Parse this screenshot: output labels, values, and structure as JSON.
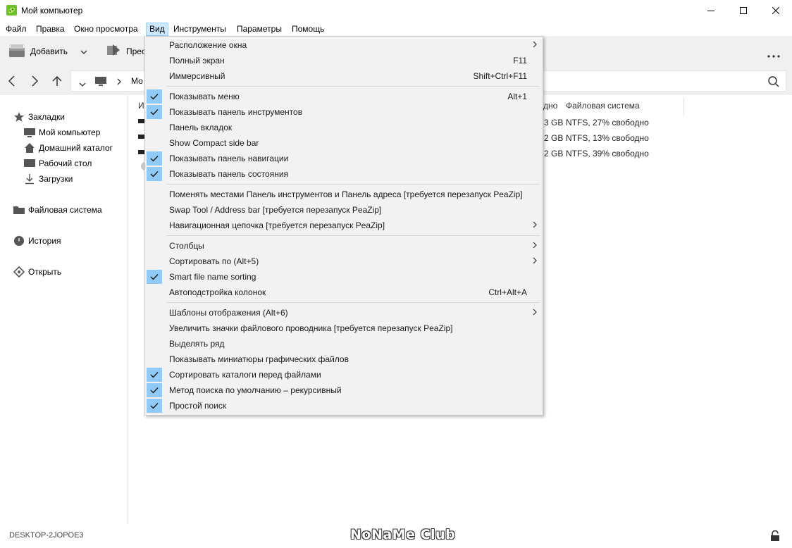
{
  "window": {
    "title": "Мой компьютер"
  },
  "menubar": {
    "items": [
      {
        "label": "Файл"
      },
      {
        "label": "Правка"
      },
      {
        "label": "Окно просмотра"
      },
      {
        "label": "Вид"
      },
      {
        "label": "Инструменты"
      },
      {
        "label": "Параметры"
      },
      {
        "label": "Помощь"
      }
    ]
  },
  "toolbar": {
    "add_label": "Добавить",
    "second_label": "Прео"
  },
  "address": {
    "path_text": "Мо"
  },
  "sidebar": {
    "bookmarks_label": "Закладки",
    "bookmark_items": [
      {
        "label": "Мой компьютер"
      },
      {
        "label": "Домашний каталог"
      },
      {
        "label": "Рабочий стол"
      },
      {
        "label": "Загрузки"
      }
    ],
    "filesystem_label": "Файловая система",
    "history_label": "История",
    "open_label": "Открыть"
  },
  "filelist": {
    "col_name_partial": "И",
    "col_free_partial": "дно",
    "col_filesystem": "Файловая система",
    "rows": [
      {
        "free_partial": "3 GB",
        "fs": "NTFS, 27% свободно"
      },
      {
        "free_partial": "2 GB",
        "fs": "NTFS, 13% свободно"
      },
      {
        "free_partial": "2 GB",
        "fs": "NTFS, 39% свободно"
      }
    ]
  },
  "menu_view": {
    "sections": [
      [
        {
          "label": "Расположение окна",
          "submenu": true
        },
        {
          "label": "Полный экран",
          "shortcut": "F11"
        },
        {
          "label": "Иммерсивный",
          "shortcut": "Shift+Ctrl+F11"
        }
      ],
      [
        {
          "label": "Показывать меню",
          "shortcut": "Alt+1",
          "checked": true
        },
        {
          "label": "Показывать панель инструментов",
          "checked": true
        },
        {
          "label": "Панель вкладок"
        },
        {
          "label": "Show Compact side bar"
        },
        {
          "label": "Показывать панель навигации",
          "checked": true
        },
        {
          "label": "Показывать панель состояния",
          "checked": true
        }
      ],
      [
        {
          "label": "Поменять местами Панель инструментов и Панель адреса [требуется перезапуск PeaZip]"
        },
        {
          "label": "Swap Tool / Address bar [требуется перезапуск PeaZip]"
        },
        {
          "label": "Навигационная цепочка [требуется перезапуск PeaZip]",
          "submenu": true
        }
      ],
      [
        {
          "label": "Столбцы",
          "submenu": true
        },
        {
          "label": "Сортировать по (Alt+5)",
          "submenu": true
        },
        {
          "label": "Smart file name sorting",
          "checked": true
        },
        {
          "label": "Автоподстройка колонок",
          "shortcut": "Ctrl+Alt+A"
        }
      ],
      [
        {
          "label": "Шаблоны отображения (Alt+6)",
          "submenu": true
        },
        {
          "label": "Увеличить значки файлового проводника [требуется перезапуск PeaZip]"
        },
        {
          "label": "Выделять ряд"
        },
        {
          "label": "Показывать миниатюры графических файлов"
        },
        {
          "label": "Сортировать каталоги перед файлами",
          "checked": true
        },
        {
          "label": "Метод поиска по умолчанию – рекурсивный",
          "checked": true
        },
        {
          "label": "Простой поиск",
          "checked": true
        }
      ]
    ]
  },
  "status": {
    "hostname": "DESKTOP-2JOPOE3",
    "watermark": "NoNaMe Club"
  },
  "colors": {
    "accent": "#91c9f7",
    "menu_active": "#cce8ff",
    "app_green": "#6cbf2a"
  }
}
